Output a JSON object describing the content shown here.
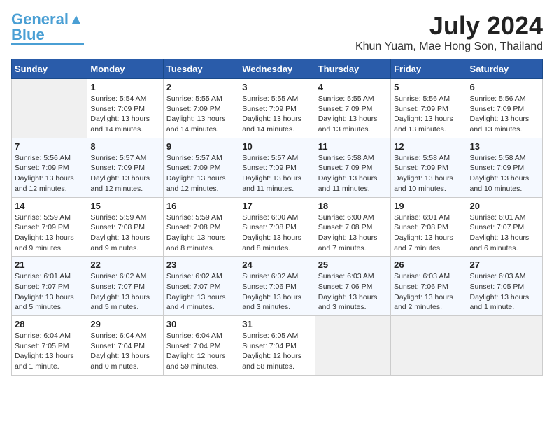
{
  "header": {
    "logo_line1": "General",
    "logo_line2": "Blue",
    "title": "July 2024",
    "subtitle": "Khun Yuam, Mae Hong Son, Thailand"
  },
  "days_of_week": [
    "Sunday",
    "Monday",
    "Tuesday",
    "Wednesday",
    "Thursday",
    "Friday",
    "Saturday"
  ],
  "weeks": [
    [
      {
        "day": "",
        "empty": true
      },
      {
        "day": "1",
        "sunrise": "5:54 AM",
        "sunset": "7:09 PM",
        "daylight": "13 hours and 14 minutes."
      },
      {
        "day": "2",
        "sunrise": "5:55 AM",
        "sunset": "7:09 PM",
        "daylight": "13 hours and 14 minutes."
      },
      {
        "day": "3",
        "sunrise": "5:55 AM",
        "sunset": "7:09 PM",
        "daylight": "13 hours and 14 minutes."
      },
      {
        "day": "4",
        "sunrise": "5:55 AM",
        "sunset": "7:09 PM",
        "daylight": "13 hours and 13 minutes."
      },
      {
        "day": "5",
        "sunrise": "5:56 AM",
        "sunset": "7:09 PM",
        "daylight": "13 hours and 13 minutes."
      },
      {
        "day": "6",
        "sunrise": "5:56 AM",
        "sunset": "7:09 PM",
        "daylight": "13 hours and 13 minutes."
      }
    ],
    [
      {
        "day": "7",
        "sunrise": "5:56 AM",
        "sunset": "7:09 PM",
        "daylight": "13 hours and 12 minutes."
      },
      {
        "day": "8",
        "sunrise": "5:57 AM",
        "sunset": "7:09 PM",
        "daylight": "13 hours and 12 minutes."
      },
      {
        "day": "9",
        "sunrise": "5:57 AM",
        "sunset": "7:09 PM",
        "daylight": "13 hours and 12 minutes."
      },
      {
        "day": "10",
        "sunrise": "5:57 AM",
        "sunset": "7:09 PM",
        "daylight": "13 hours and 11 minutes."
      },
      {
        "day": "11",
        "sunrise": "5:58 AM",
        "sunset": "7:09 PM",
        "daylight": "13 hours and 11 minutes."
      },
      {
        "day": "12",
        "sunrise": "5:58 AM",
        "sunset": "7:09 PM",
        "daylight": "13 hours and 10 minutes."
      },
      {
        "day": "13",
        "sunrise": "5:58 AM",
        "sunset": "7:09 PM",
        "daylight": "13 hours and 10 minutes."
      }
    ],
    [
      {
        "day": "14",
        "sunrise": "5:59 AM",
        "sunset": "7:09 PM",
        "daylight": "13 hours and 9 minutes."
      },
      {
        "day": "15",
        "sunrise": "5:59 AM",
        "sunset": "7:08 PM",
        "daylight": "13 hours and 9 minutes."
      },
      {
        "day": "16",
        "sunrise": "5:59 AM",
        "sunset": "7:08 PM",
        "daylight": "13 hours and 8 minutes."
      },
      {
        "day": "17",
        "sunrise": "6:00 AM",
        "sunset": "7:08 PM",
        "daylight": "13 hours and 8 minutes."
      },
      {
        "day": "18",
        "sunrise": "6:00 AM",
        "sunset": "7:08 PM",
        "daylight": "13 hours and 7 minutes."
      },
      {
        "day": "19",
        "sunrise": "6:01 AM",
        "sunset": "7:08 PM",
        "daylight": "13 hours and 7 minutes."
      },
      {
        "day": "20",
        "sunrise": "6:01 AM",
        "sunset": "7:07 PM",
        "daylight": "13 hours and 6 minutes."
      }
    ],
    [
      {
        "day": "21",
        "sunrise": "6:01 AM",
        "sunset": "7:07 PM",
        "daylight": "13 hours and 5 minutes."
      },
      {
        "day": "22",
        "sunrise": "6:02 AM",
        "sunset": "7:07 PM",
        "daylight": "13 hours and 5 minutes."
      },
      {
        "day": "23",
        "sunrise": "6:02 AM",
        "sunset": "7:07 PM",
        "daylight": "13 hours and 4 minutes."
      },
      {
        "day": "24",
        "sunrise": "6:02 AM",
        "sunset": "7:06 PM",
        "daylight": "13 hours and 3 minutes."
      },
      {
        "day": "25",
        "sunrise": "6:03 AM",
        "sunset": "7:06 PM",
        "daylight": "13 hours and 3 minutes."
      },
      {
        "day": "26",
        "sunrise": "6:03 AM",
        "sunset": "7:06 PM",
        "daylight": "13 hours and 2 minutes."
      },
      {
        "day": "27",
        "sunrise": "6:03 AM",
        "sunset": "7:05 PM",
        "daylight": "13 hours and 1 minute."
      }
    ],
    [
      {
        "day": "28",
        "sunrise": "6:04 AM",
        "sunset": "7:05 PM",
        "daylight": "13 hours and 1 minute."
      },
      {
        "day": "29",
        "sunrise": "6:04 AM",
        "sunset": "7:04 PM",
        "daylight": "13 hours and 0 minutes."
      },
      {
        "day": "30",
        "sunrise": "6:04 AM",
        "sunset": "7:04 PM",
        "daylight": "12 hours and 59 minutes."
      },
      {
        "day": "31",
        "sunrise": "6:05 AM",
        "sunset": "7:04 PM",
        "daylight": "12 hours and 58 minutes."
      },
      {
        "day": "",
        "empty": true
      },
      {
        "day": "",
        "empty": true
      },
      {
        "day": "",
        "empty": true
      }
    ]
  ]
}
